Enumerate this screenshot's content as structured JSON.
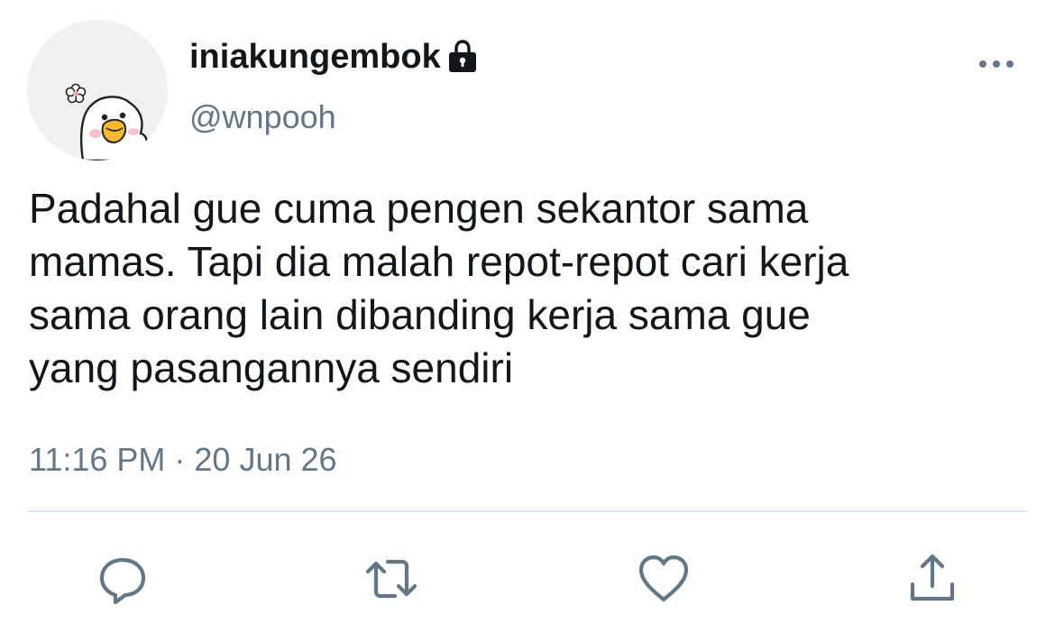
{
  "user": {
    "display_name": "iniakungembok",
    "handle": "@wnpooh",
    "protected_icon": "lock-icon",
    "avatar_icon": "duck-avatar"
  },
  "tweet": {
    "text": "Padahal gue cuma pengen sekantor sama\nmamas. Tapi dia malah repot-repot cari kerja\nsama orang lain dibanding kerja sama gue\nyang pasangannya sendiri",
    "timestamp": "11:16 PM · 20 Jun 26"
  },
  "actions": {
    "more_icon": "more-dots-icon",
    "reply_icon": "reply-icon",
    "retweet_icon": "retweet-icon",
    "like_icon": "heart-icon",
    "share_icon": "share-icon"
  },
  "colors": {
    "text": "#14171a",
    "secondary": "#657786",
    "icon": "#657786",
    "divider": "#e1e8ed",
    "avatar_bg": "#f1f1f1",
    "duck_beak": "#f5b82e"
  }
}
